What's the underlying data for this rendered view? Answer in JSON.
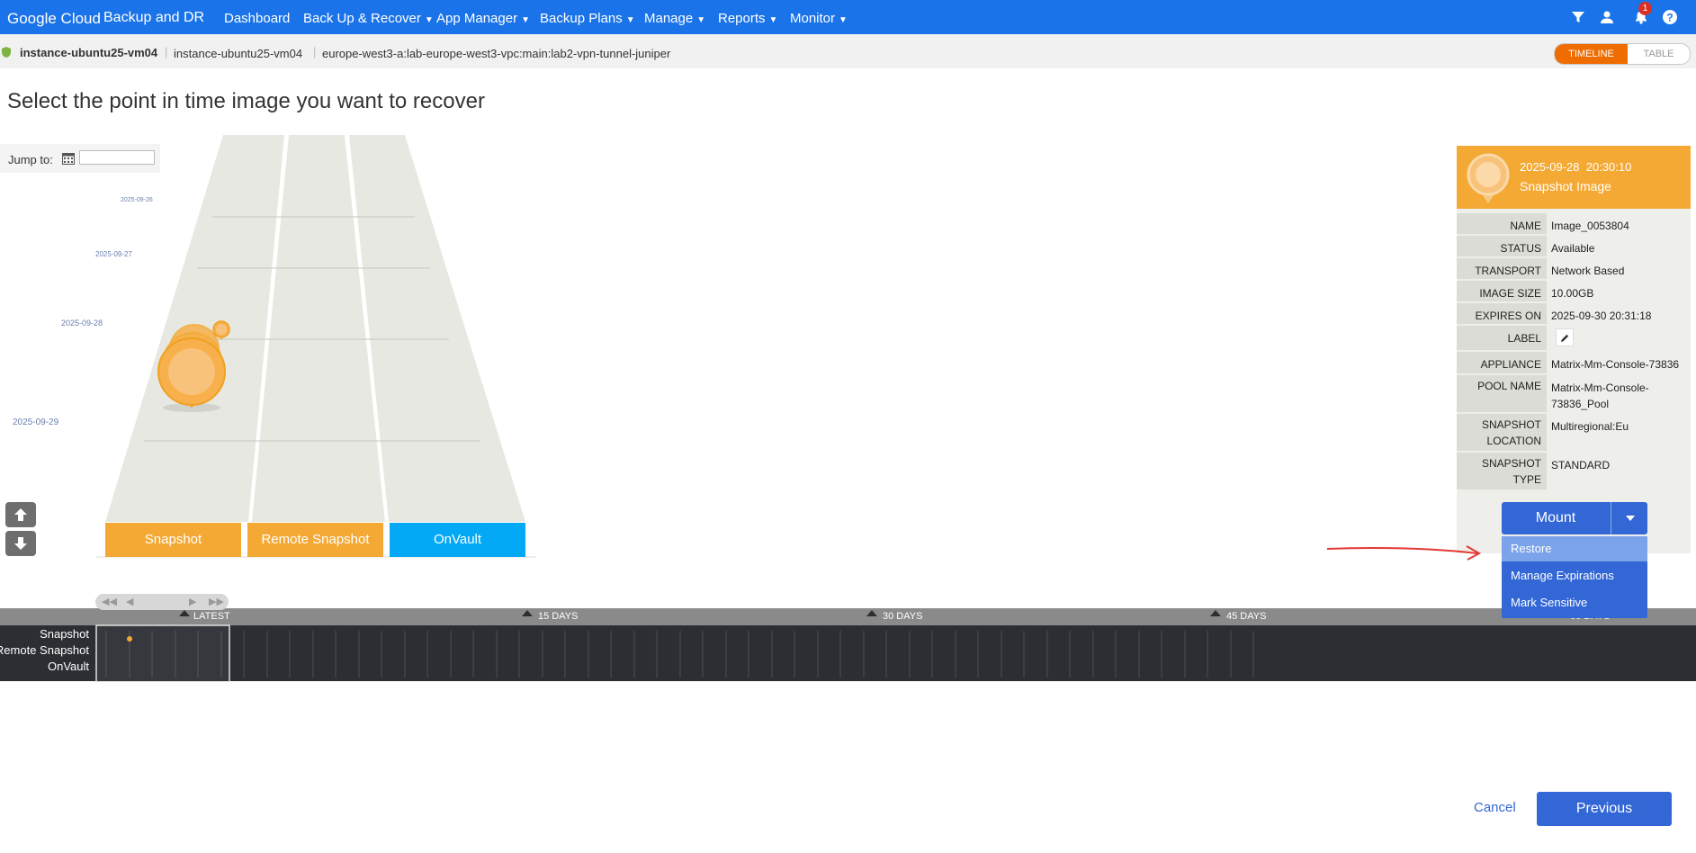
{
  "nav": {
    "brand": "Google Cloud",
    "product": "Backup and DR",
    "items": [
      "Dashboard",
      "Back Up & Recover",
      "App Manager",
      "Backup Plans",
      "Manage",
      "Reports",
      "Monitor"
    ],
    "notification_count": "1"
  },
  "subbar": {
    "instance_name": "instance-ubuntu25-vm04",
    "instance_name2": "instance-ubuntu25-vm04",
    "path": "europe-west3-a:lab-europe-west3-vpc:main:lab2-vpn-tunnel-juniper",
    "view_active": "TIMELINE",
    "view_other": "TABLE"
  },
  "page_title": "Select the point in time image you want to recover",
  "jump": {
    "label": "Jump to:",
    "value": ""
  },
  "lane_dates": [
    "2025-09-26",
    "2025-09-27",
    "2025-09-28",
    "2025-09-29"
  ],
  "lanes": [
    {
      "label": "Snapshot",
      "color": "#f4a934"
    },
    {
      "label": "Remote Snapshot",
      "color": "#f4a934"
    },
    {
      "label": "OnVault",
      "color": "#03a9f4"
    }
  ],
  "timeline": {
    "marks": [
      "LATEST",
      "15 DAYS",
      "30 DAYS",
      "45 DAYS",
      "60 DAYS"
    ],
    "rows": [
      "Snapshot",
      "Remote Snapshot",
      "OnVault"
    ]
  },
  "details": {
    "date": "2025-09-28",
    "time": "20:30:10",
    "type": "Snapshot Image",
    "rows": [
      {
        "key": "NAME",
        "value": "Image_0053804"
      },
      {
        "key": "STATUS",
        "value": "Available"
      },
      {
        "key": "TRANSPORT",
        "value": "Network Based"
      },
      {
        "key": "IMAGE SIZE",
        "value": "10.00GB"
      },
      {
        "key": "EXPIRES ON",
        "value": "2025-09-30 20:31:18"
      },
      {
        "key": "LABEL",
        "value": ""
      },
      {
        "key": "APPLIANCE",
        "value": "Matrix-Mm-Console-73836"
      },
      {
        "key": "POOL NAME",
        "value": "Matrix-Mm-Console-73836_Pool"
      },
      {
        "key": "SNAPSHOT LOCATION",
        "value": "Multiregional:Eu"
      },
      {
        "key": "SNAPSHOT TYPE",
        "value": "STANDARD"
      }
    ]
  },
  "actions": {
    "mount": "Mount",
    "menu": [
      "Restore",
      "Manage Expirations",
      "Mark Sensitive"
    ],
    "cancel": "Cancel",
    "previous": "Previous"
  },
  "colors": {
    "nav": "#1a73e8",
    "accent": "#3367d6",
    "snapshot": "#f4a934",
    "onvault": "#03a9f4",
    "toggle_on": "#ef6c00",
    "annotation": "#e53935"
  }
}
